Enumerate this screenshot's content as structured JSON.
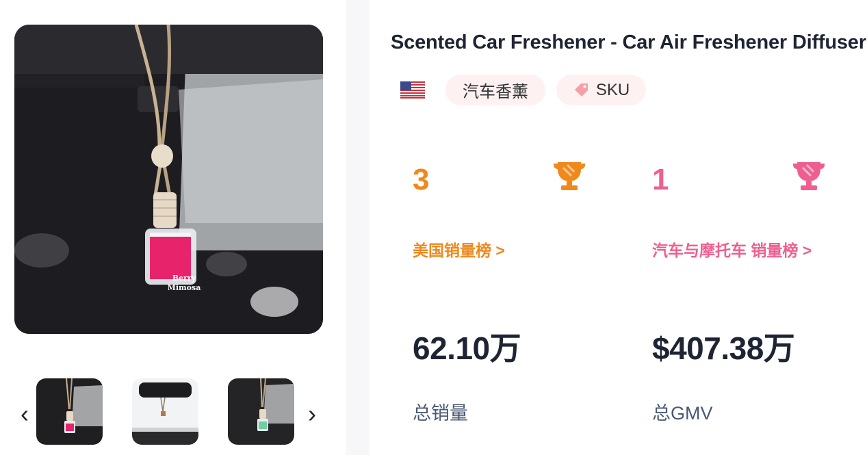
{
  "product": {
    "title": "Scented Car Freshener - Car Air Freshener Diffuser",
    "bottle_label": [
      "Berry",
      "Mimosa"
    ],
    "region_flag": "us-flag-icon",
    "category_tag": "汽车香薰",
    "sku_tag": "SKU"
  },
  "gallery": {
    "prev_arrow": "‹",
    "next_arrow": "›"
  },
  "rankings": [
    {
      "rank": "3",
      "label": "美国销量榜",
      "chevron": ">",
      "color": "#f0891c"
    },
    {
      "rank": "1",
      "label": "汽车与摩托车 销量榜",
      "chevron": ">",
      "color": "#ee5f8f"
    }
  ],
  "stats": [
    {
      "value": "62.10万",
      "label": "总销量"
    },
    {
      "value": "$407.38万",
      "label": "总GMV"
    }
  ],
  "colors": {
    "title": "#1e2433",
    "tag_bg": "#fdf1f2",
    "sku_icon": "#f5a0a8",
    "stat_label": "#4a5a74"
  }
}
